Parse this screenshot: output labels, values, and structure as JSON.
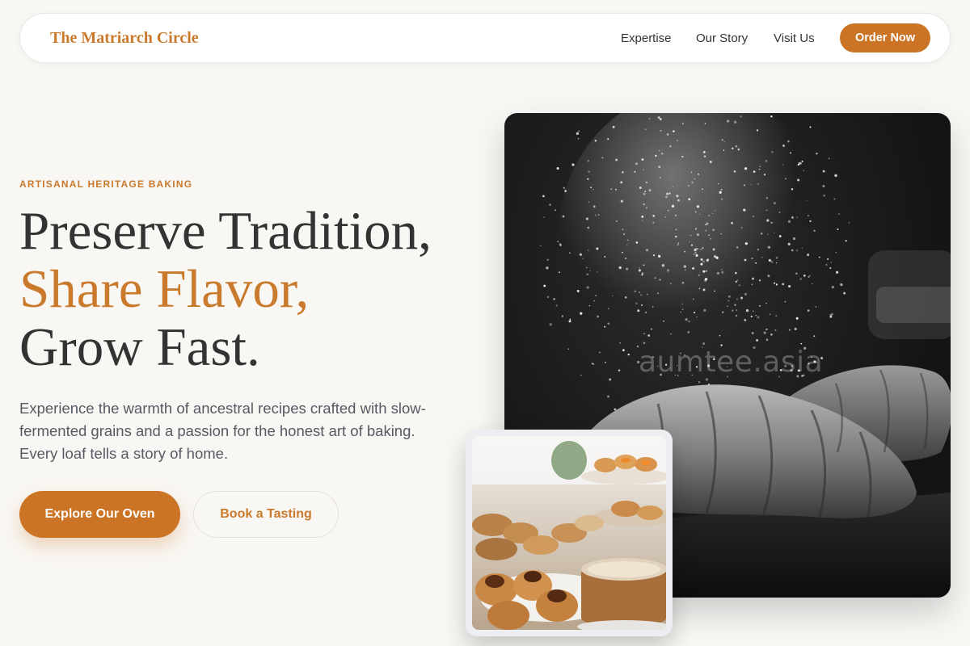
{
  "nav": {
    "brand": "The Matriarch Circle",
    "links": [
      "Expertise",
      "Our Story",
      "Visit Us"
    ],
    "cta": "Order Now"
  },
  "hero": {
    "eyebrow": "ARTISANAL HERITAGE BAKING",
    "headline": {
      "line1": "Preserve Tradition,",
      "line2": "Share Flavor,",
      "line3": "Grow Fast."
    },
    "body": "Experience the warmth of ancestral recipes crafted with slow-fermented grains and a passion for the honest art of baking. Every loaf tells a story of home.",
    "primary_cta": "Explore Our Oven",
    "secondary_cta": "Book a Tasting"
  },
  "media": {
    "main_image": "flour-dusted-croissants-photo",
    "inset_image": "pastry-display-photo",
    "watermark": "aumtee.asia"
  },
  "colors": {
    "accent": "#c97a2c",
    "button": "#cc7425",
    "background": "#f9f7f4",
    "text": "#333333",
    "body_text": "#555a63"
  }
}
